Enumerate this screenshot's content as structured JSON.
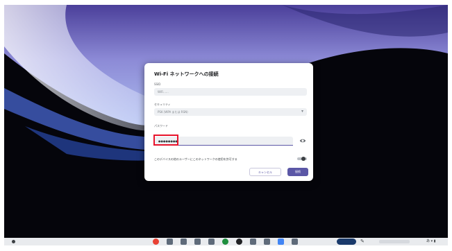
{
  "dialog": {
    "title": "Wi-Fi ネットワークへの接続",
    "ssid_label": "SSID",
    "ssid_value": "WiFi......",
    "security_label": "セキュリティ",
    "security_value": "PSK (WPA または RSN)",
    "password_label": "パスワード",
    "password_value": "●●●●●●●●",
    "allow_others_label": "このデバイスの他のユーザーにこのネットワークの使用を許可する",
    "cancel_label": "キャンセル",
    "connect_label": "接続"
  },
  "taskbar": {
    "pinned_apps": [
      {
        "icon": "chrome-icon",
        "color": "#e94235"
      },
      {
        "icon": "files-icon",
        "color": "#5f6b7a"
      },
      {
        "icon": "gmail-icon",
        "color": "#5f6b7a"
      },
      {
        "icon": "docs-icon",
        "color": "#5f6b7a"
      },
      {
        "icon": "calendar-icon",
        "color": "#5f6b7a"
      },
      {
        "icon": "chat-icon",
        "color": "#1e8e3e"
      },
      {
        "icon": "camera-icon",
        "color": "#202124"
      },
      {
        "icon": "settings-icon",
        "color": "#5f6b7a"
      },
      {
        "icon": "play-store-icon",
        "color": "#5f6b7a"
      },
      {
        "icon": "drive-icon",
        "color": "#4285f4"
      },
      {
        "icon": "app-icon",
        "color": "#5f6b7a"
      }
    ]
  },
  "colors": {
    "accent": "#5b57a6",
    "highlight": "#e8122b"
  }
}
